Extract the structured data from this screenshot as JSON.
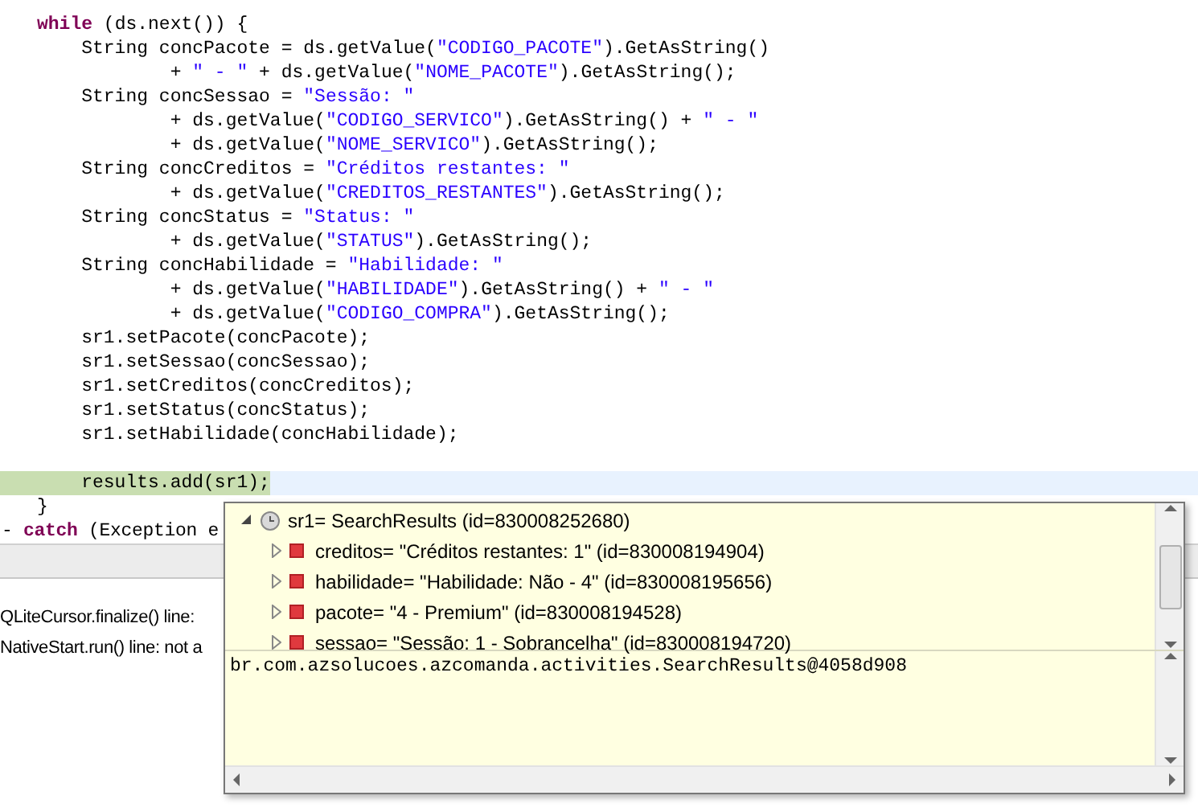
{
  "editor": {
    "lines": [
      {
        "highlighted": false,
        "tokens": [
          {
            "kind": "keyword",
            "text": "while"
          },
          {
            "kind": "plain",
            "text": " (ds.next()) {"
          }
        ]
      },
      {
        "highlighted": false,
        "tokens": [
          {
            "kind": "plain",
            "text": "    String concPacote = ds.getValue("
          },
          {
            "kind": "string",
            "text": "\"CODIGO_PACOTE\""
          },
          {
            "kind": "plain",
            "text": ").GetAsString()"
          }
        ]
      },
      {
        "highlighted": false,
        "tokens": [
          {
            "kind": "plain",
            "text": "            + "
          },
          {
            "kind": "string",
            "text": "\" - \""
          },
          {
            "kind": "plain",
            "text": " + ds.getValue("
          },
          {
            "kind": "string",
            "text": "\"NOME_PACOTE\""
          },
          {
            "kind": "plain",
            "text": ").GetAsString();"
          }
        ]
      },
      {
        "highlighted": false,
        "tokens": [
          {
            "kind": "plain",
            "text": "    String concSessao = "
          },
          {
            "kind": "string",
            "text": "\"Sessão: \""
          }
        ]
      },
      {
        "highlighted": false,
        "tokens": [
          {
            "kind": "plain",
            "text": "            + ds.getValue("
          },
          {
            "kind": "string",
            "text": "\"CODIGO_SERVICO\""
          },
          {
            "kind": "plain",
            "text": ").GetAsString() + "
          },
          {
            "kind": "string",
            "text": "\" - \""
          }
        ]
      },
      {
        "highlighted": false,
        "tokens": [
          {
            "kind": "plain",
            "text": "            + ds.getValue("
          },
          {
            "kind": "string",
            "text": "\"NOME_SERVICO\""
          },
          {
            "kind": "plain",
            "text": ").GetAsString();"
          }
        ]
      },
      {
        "highlighted": false,
        "tokens": [
          {
            "kind": "plain",
            "text": "    String concCreditos = "
          },
          {
            "kind": "string",
            "text": "\"Créditos restantes: \""
          }
        ]
      },
      {
        "highlighted": false,
        "tokens": [
          {
            "kind": "plain",
            "text": "            + ds.getValue("
          },
          {
            "kind": "string",
            "text": "\"CREDITOS_RESTANTES\""
          },
          {
            "kind": "plain",
            "text": ").GetAsString();"
          }
        ]
      },
      {
        "highlighted": false,
        "tokens": [
          {
            "kind": "plain",
            "text": "    String concStatus = "
          },
          {
            "kind": "string",
            "text": "\"Status: \""
          }
        ]
      },
      {
        "highlighted": false,
        "tokens": [
          {
            "kind": "plain",
            "text": "            + ds.getValue("
          },
          {
            "kind": "string",
            "text": "\"STATUS\""
          },
          {
            "kind": "plain",
            "text": ").GetAsString();"
          }
        ]
      },
      {
        "highlighted": false,
        "tokens": [
          {
            "kind": "plain",
            "text": "    String concHabilidade = "
          },
          {
            "kind": "string",
            "text": "\"Habilidade: \""
          }
        ]
      },
      {
        "highlighted": false,
        "tokens": [
          {
            "kind": "plain",
            "text": "            + ds.getValue("
          },
          {
            "kind": "string",
            "text": "\"HABILIDADE\""
          },
          {
            "kind": "plain",
            "text": ").GetAsString() + "
          },
          {
            "kind": "string",
            "text": "\" - \""
          }
        ]
      },
      {
        "highlighted": false,
        "tokens": [
          {
            "kind": "plain",
            "text": "            + ds.getValue("
          },
          {
            "kind": "string",
            "text": "\"CODIGO_COMPRA\""
          },
          {
            "kind": "plain",
            "text": ").GetAsString();"
          }
        ]
      },
      {
        "highlighted": false,
        "tokens": [
          {
            "kind": "plain",
            "text": "    sr1.setPacote(concPacote);"
          }
        ]
      },
      {
        "highlighted": false,
        "tokens": [
          {
            "kind": "plain",
            "text": "    sr1.setSessao(concSessao);"
          }
        ]
      },
      {
        "highlighted": false,
        "tokens": [
          {
            "kind": "plain",
            "text": "    sr1.setCreditos(concCreditos);"
          }
        ]
      },
      {
        "highlighted": false,
        "tokens": [
          {
            "kind": "plain",
            "text": "    sr1.setStatus(concStatus);"
          }
        ]
      },
      {
        "highlighted": false,
        "tokens": [
          {
            "kind": "plain",
            "text": "    sr1.setHabilidade(concHabilidade);"
          }
        ]
      },
      {
        "kind": "blank"
      },
      {
        "highlighted": true,
        "tokens": [
          {
            "kind": "plain",
            "text": "    results.add(sr1);"
          }
        ]
      },
      {
        "highlighted": false,
        "tokens": [
          {
            "kind": "plain",
            "text": "}"
          }
        ]
      },
      {
        "highlighted": false,
        "tokens": [
          {
            "kind": "plain",
            "text": "- "
          },
          {
            "kind": "keyword",
            "text": "catch"
          },
          {
            "kind": "plain",
            "text": " (Exception e"
          }
        ]
      }
    ]
  },
  "stack_panel": {
    "lines": [
      "QLiteCursor.finalize() line:",
      "NativeStart.run() line: not a"
    ]
  },
  "inspect_popup": {
    "root": {
      "label": "sr1= SearchResults  (id=830008252680)",
      "expanded": true,
      "children": [
        {
          "label": "creditos= \"Créditos restantes: 1\" (id=830008194904)",
          "expanded": false
        },
        {
          "label": "habilidade= \"Habilidade: Não - 4\" (id=830008195656)",
          "expanded": false
        },
        {
          "label": "pacote= \"4 - Premium\" (id=830008194528)",
          "expanded": false
        },
        {
          "label": "sessao= \"Sessão: 1 - Sobrancelha\" (id=830008194720)",
          "expanded": false
        }
      ]
    },
    "detail": "br.com.azsolucoes.azcomanda.activities.SearchResults@4058d908"
  }
}
